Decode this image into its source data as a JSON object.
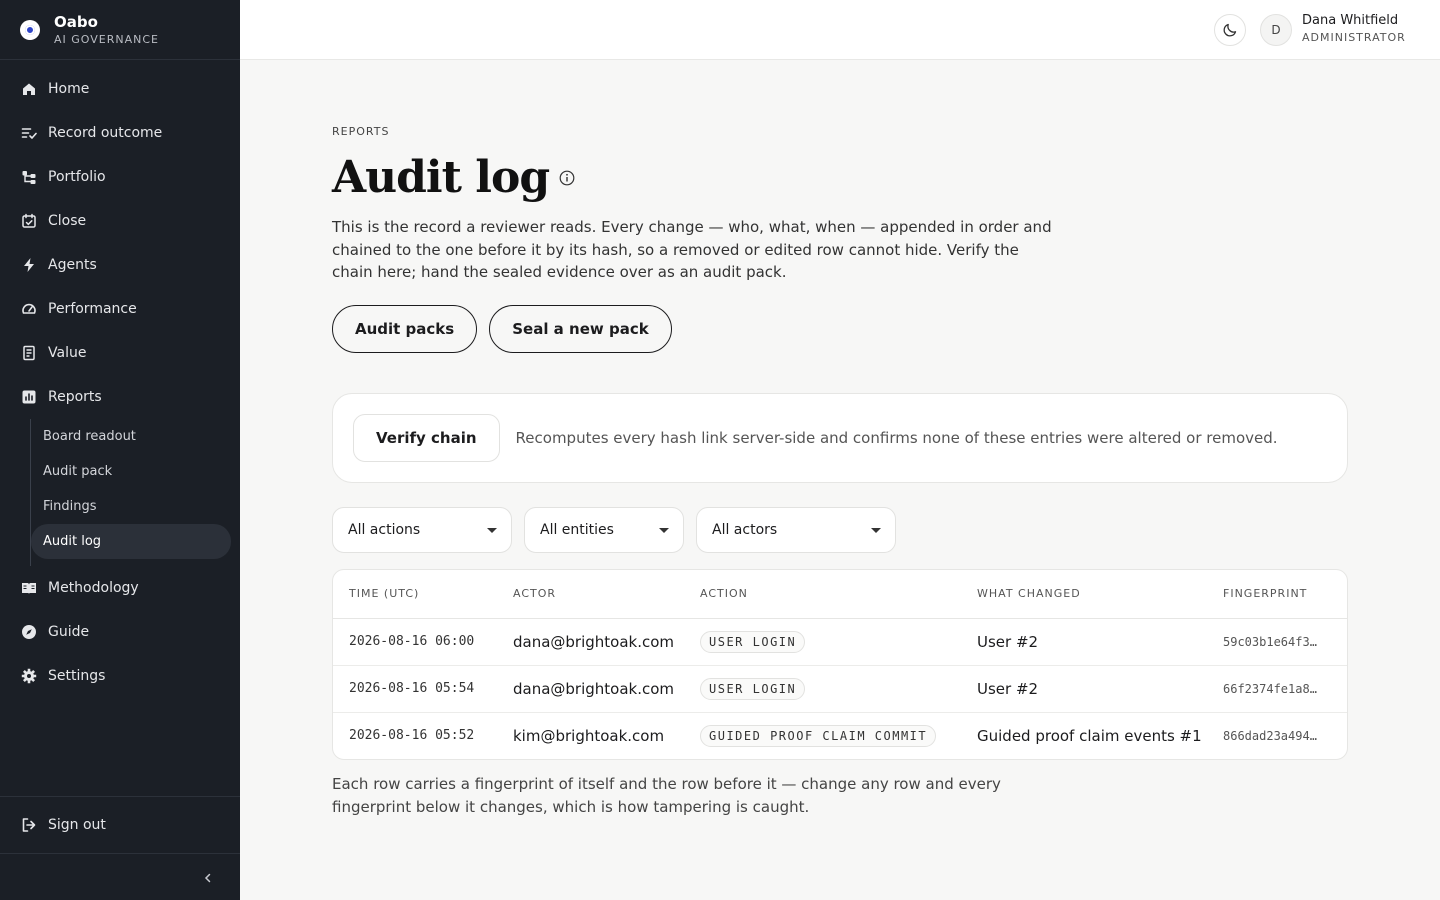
{
  "brand": {
    "name": "Oabo",
    "subtitle": "AI GOVERNANCE"
  },
  "nav": {
    "items": [
      {
        "label": "Home",
        "icon": "home-icon"
      },
      {
        "label": "Record outcome",
        "icon": "list-check-icon"
      },
      {
        "label": "Portfolio",
        "icon": "portfolio-icon"
      },
      {
        "label": "Close",
        "icon": "calendar-check-icon"
      },
      {
        "label": "Agents",
        "icon": "bolt-icon"
      },
      {
        "label": "Performance",
        "icon": "gauge-icon"
      },
      {
        "label": "Value",
        "icon": "ledger-icon"
      },
      {
        "label": "Reports",
        "icon": "bar-chart-icon"
      }
    ],
    "reports_sub": [
      {
        "label": "Board readout"
      },
      {
        "label": "Audit pack"
      },
      {
        "label": "Findings"
      },
      {
        "label": "Audit log",
        "active": true
      }
    ],
    "items_after": [
      {
        "label": "Methodology",
        "icon": "book-icon"
      },
      {
        "label": "Guide",
        "icon": "compass-icon"
      },
      {
        "label": "Settings",
        "icon": "gear-icon"
      }
    ],
    "sign_out": "Sign out"
  },
  "header": {
    "user": {
      "initial": "D",
      "name": "Dana Whitfield",
      "role": "ADMINISTRATOR"
    }
  },
  "page": {
    "eyebrow": "REPORTS",
    "title": "Audit log",
    "description": "This is the record a reviewer reads. Every change — who, what, when — appended in order and chained to the one before it by its hash, so a removed or edited row cannot hide. Verify the chain here; hand the sealed evidence over as an audit pack.",
    "buttons": {
      "audit_packs": "Audit packs",
      "seal_pack": "Seal a new pack"
    },
    "verify": {
      "button": "Verify chain",
      "text": "Recomputes every hash link server-side and confirms none of these entries were altered or removed."
    },
    "filters": {
      "actions": "All actions",
      "entities": "All entities",
      "actors": "All actors"
    },
    "table": {
      "columns": [
        "TIME (UTC)",
        "ACTOR",
        "ACTION",
        "WHAT CHANGED",
        "FINGERPRINT"
      ],
      "rows": [
        {
          "time": "2026-08-16 06:00",
          "actor": "dana@brightoak.com",
          "action": "USER LOGIN",
          "changed": "User #2",
          "fingerprint": "59c03b1e64f3…"
        },
        {
          "time": "2026-08-16 05:54",
          "actor": "dana@brightoak.com",
          "action": "USER LOGIN",
          "changed": "User #2",
          "fingerprint": "66f2374fe1a8…"
        },
        {
          "time": "2026-08-16 05:52",
          "actor": "kim@brightoak.com",
          "action": "GUIDED PROOF CLAIM COMMIT",
          "changed": "Guided proof claim events #1",
          "fingerprint": "866dad23a494…"
        }
      ]
    },
    "footnote": "Each row carries a fingerprint of itself and the row before it — change any row and every fingerprint below it changes, which is how tampering is caught."
  }
}
